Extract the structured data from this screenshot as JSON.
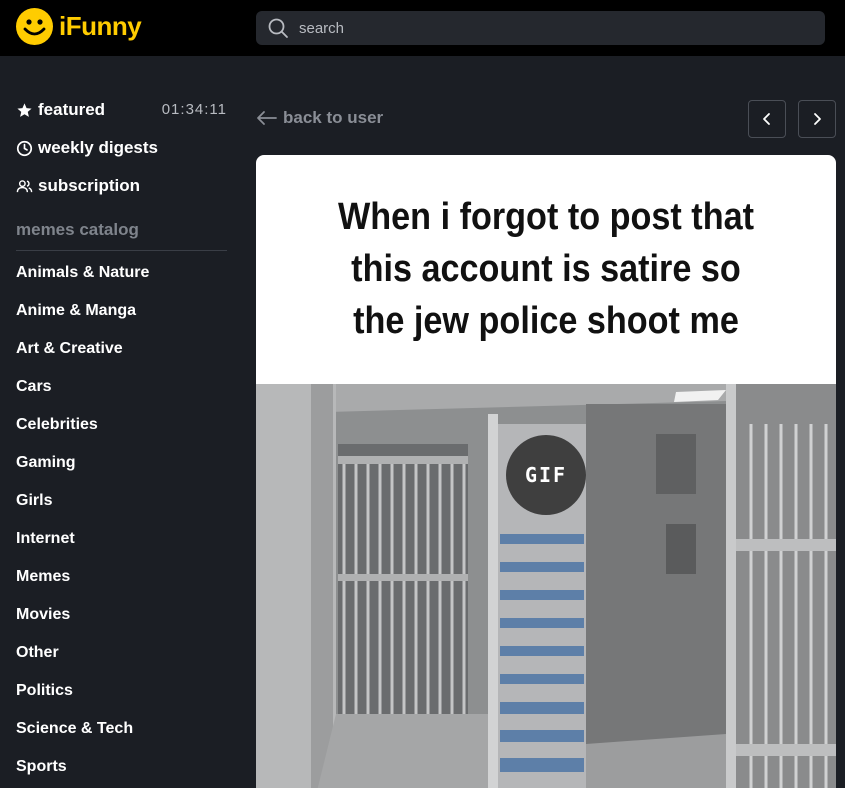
{
  "app": {
    "logo_text": "iFunny",
    "brand_color": "#ffcc00"
  },
  "search": {
    "placeholder": "search",
    "value": ""
  },
  "sidebar": {
    "nav": [
      {
        "label": "featured",
        "icon": "star-icon"
      },
      {
        "label": "weekly digests",
        "icon": "clock-icon"
      },
      {
        "label": "subscription",
        "icon": "users-icon"
      }
    ],
    "timer": "01:34:11",
    "catalog_title": "memes catalog",
    "categories": [
      "Animals & Nature",
      "Anime & Manga",
      "Art & Creative",
      "Cars",
      "Celebrities",
      "Gaming",
      "Girls",
      "Internet",
      "Memes",
      "Movies",
      "Other",
      "Politics",
      "Science & Tech",
      "Sports"
    ]
  },
  "main": {
    "back_label": "back to user",
    "post": {
      "caption_lines": [
        "When i forgot to post that",
        "this account is satire so",
        "the jew police shoot me"
      ],
      "badge": "GIF"
    }
  }
}
